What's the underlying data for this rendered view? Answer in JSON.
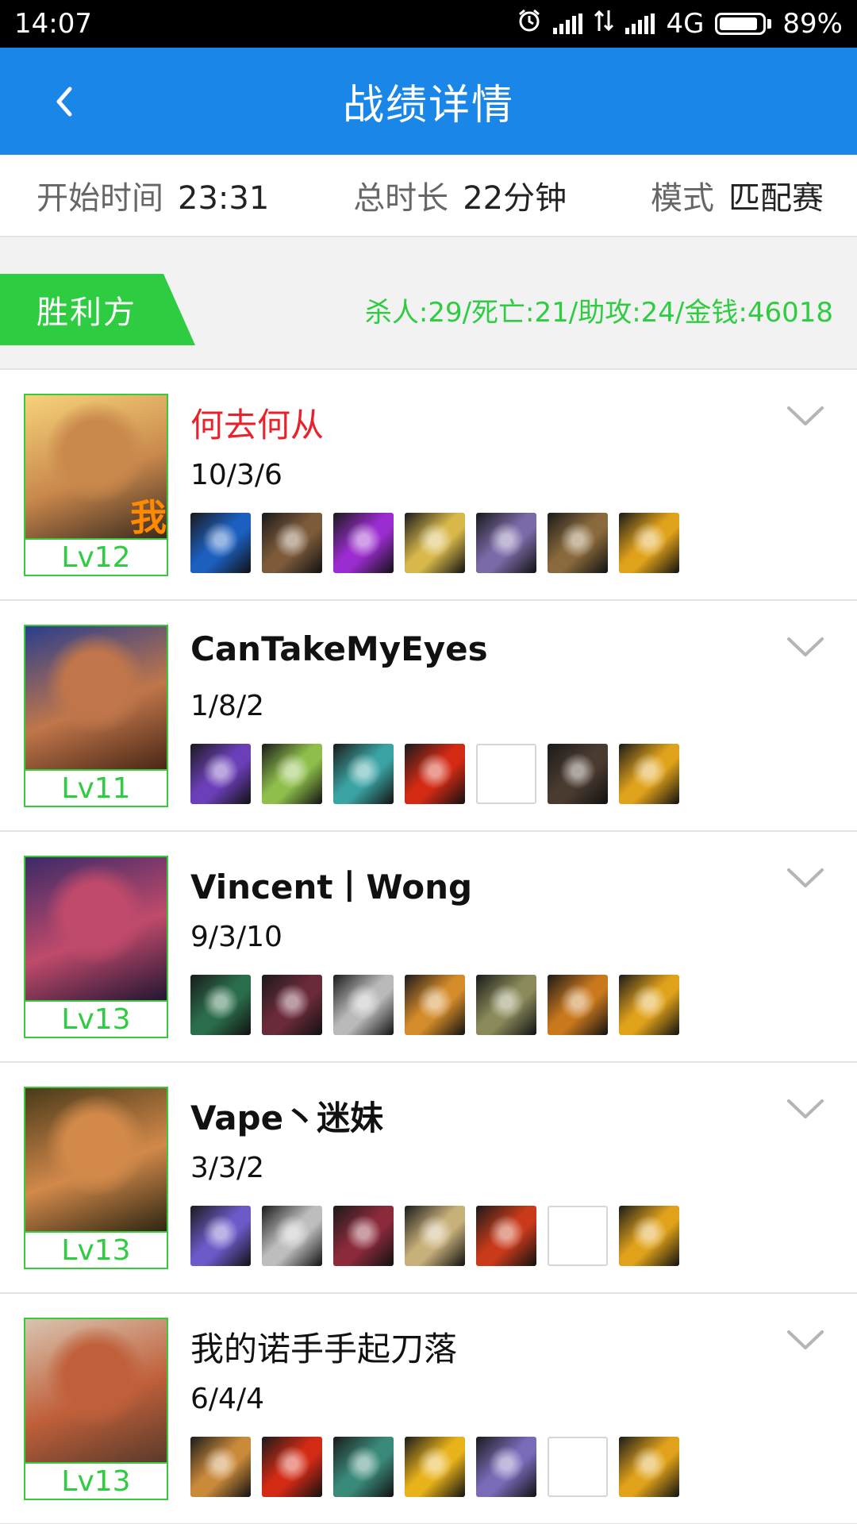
{
  "status_bar": {
    "time": "14:07",
    "network": "4G",
    "battery": "89%",
    "battery_level": 0.89
  },
  "header": {
    "title": "战绩详情"
  },
  "match_info": {
    "start_label": "开始时间",
    "start_value": "23:31",
    "duration_label": "总时长",
    "duration_value": "22分钟",
    "mode_label": "模式",
    "mode_value": "匹配赛"
  },
  "team": {
    "label": "胜利方",
    "stats": "杀人:29/死亡:21/助攻:24/金钱:46018",
    "color": "#2ecc40"
  },
  "players": [
    {
      "name": "何去何从",
      "kda": "10/3/6",
      "level": "Lv12",
      "me": "我",
      "highlight": true,
      "portrait_colors": [
        "#f6d37a",
        "#c9884c",
        "#3b2a1f"
      ],
      "items": [
        "#1c5fbf",
        "#7c5a3a",
        "#9b2ccf",
        "#d8b84a",
        "#7b6aa8",
        "#8a6a3c",
        "#e0a21a"
      ]
    },
    {
      "name": "CanTakeMyEyes",
      "kda": "1/8/2",
      "level": "Lv11",
      "bold": true,
      "portrait_colors": [
        "#2a3e8c",
        "#c0764a",
        "#4a2716"
      ],
      "items": [
        "#6b3fb8",
        "#8fbf4a",
        "#3aa3a3",
        "#d32a14",
        "",
        "#4a3b30",
        "#e0a21a"
      ]
    },
    {
      "name": "Vincent丨Wong",
      "kda": "9/3/10",
      "level": "Lv13",
      "bold": true,
      "portrait_colors": [
        "#3b2a68",
        "#c04a6b",
        "#231633"
      ],
      "items": [
        "#2a6d4a",
        "#6b2a3a",
        "#b9b9b9",
        "#d48b2a",
        "#8a8a5a",
        "#c9781c",
        "#e0a21a"
      ]
    },
    {
      "name": "Vape丶迷妹",
      "kda": "3/3/2",
      "level": "Lv13",
      "bold": true,
      "portrait_colors": [
        "#4a3a1a",
        "#d2894a",
        "#2e2612"
      ],
      "items": [
        "#6b5ac8",
        "#bdbdbd",
        "#8a2a3a",
        "#c8b07a",
        "#c83a1a",
        "",
        "#e0a21a"
      ]
    },
    {
      "name": "我的诺手手起刀落",
      "kda": "6/4/4",
      "level": "Lv13",
      "portrait_colors": [
        "#d8c4b0",
        "#c0603a",
        "#5a3a2a"
      ],
      "items": [
        "#c98a3a",
        "#d32a14",
        "#3a8a7a",
        "#e8b21a",
        "#7a6ab8",
        "",
        "#e0a21a"
      ]
    }
  ]
}
